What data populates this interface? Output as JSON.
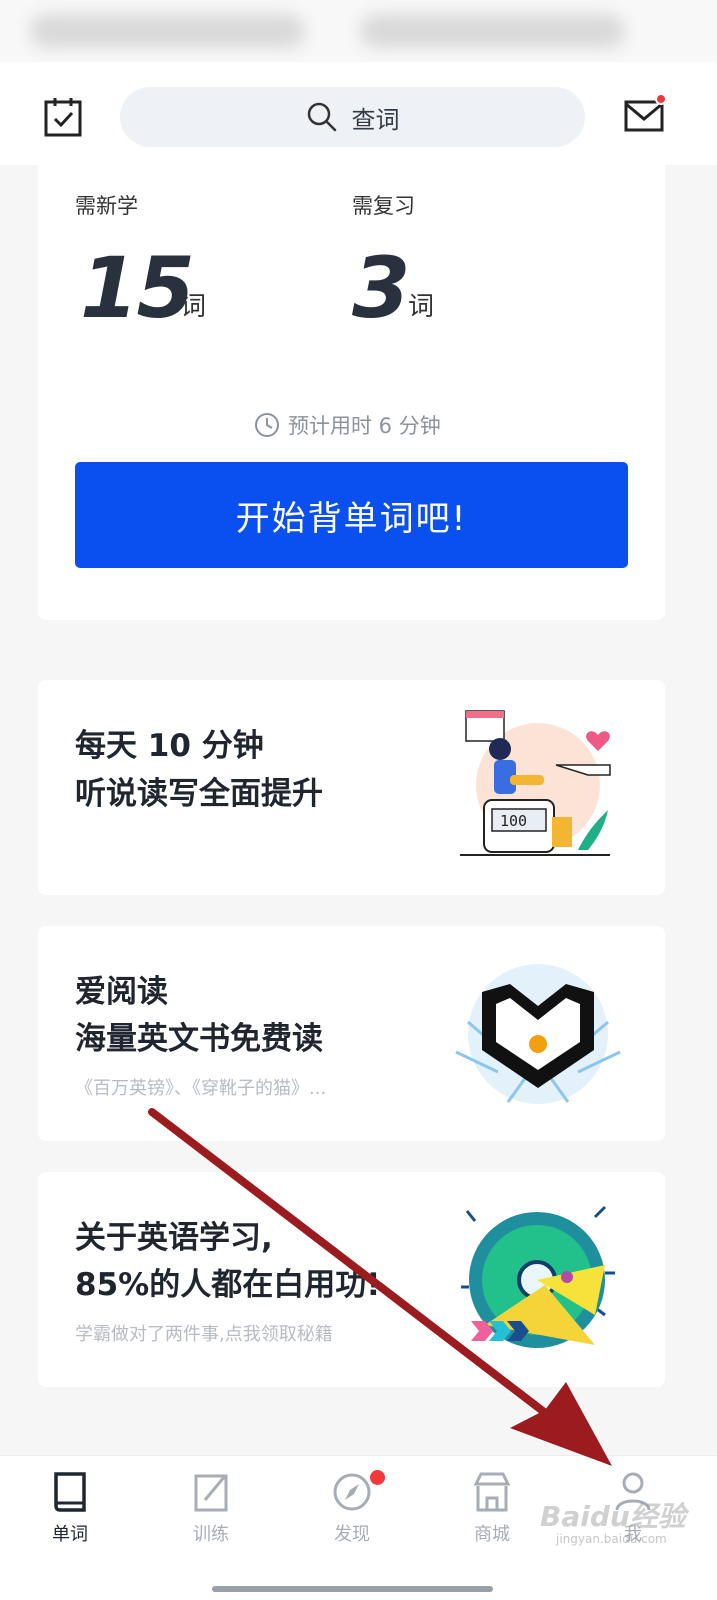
{
  "header": {
    "search_placeholder": "查词"
  },
  "stats": {
    "new_label": "需新学",
    "new_count": "15",
    "review_label": "需复习",
    "review_count": "3",
    "unit": "词",
    "estimate": "预计用时 6 分钟"
  },
  "start_button": "开始背单词吧!",
  "promos": [
    {
      "line1": "每天 10 分钟",
      "line2": "听说读写全面提升",
      "sub": ""
    },
    {
      "line1": "爱阅读",
      "line2": "海量英文书免费读",
      "sub": "《百万英镑》、《穿靴子的猫》..."
    },
    {
      "line1": "关于英语学习,",
      "line2": "85%的人都在白用功!",
      "sub": "学霸做对了两件事,点我领取秘籍"
    }
  ],
  "nav": [
    {
      "label": "单词",
      "icon": "book-icon",
      "active": true
    },
    {
      "label": "训练",
      "icon": "edit-icon",
      "active": false
    },
    {
      "label": "发现",
      "icon": "compass-icon",
      "active": false
    },
    {
      "label": "商城",
      "icon": "store-icon",
      "active": false
    },
    {
      "label": "我",
      "icon": "person-icon",
      "active": false
    }
  ],
  "watermark": {
    "brand": "Baidu经验",
    "url": "jingyan.baidu.com"
  },
  "colors": {
    "accent": "#0a4ff0",
    "badge": "#f23a3a",
    "annotation_arrow": "#9b1b1f"
  }
}
